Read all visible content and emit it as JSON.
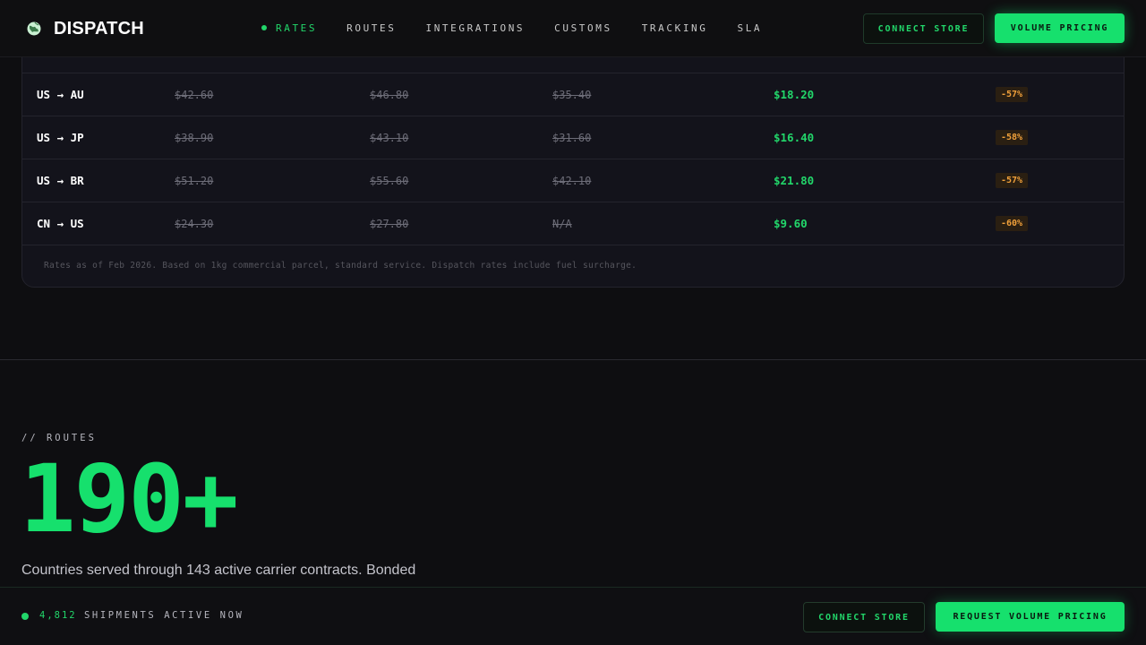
{
  "brand": {
    "name": "DISPATCH",
    "icon": "globe-icon"
  },
  "nav": {
    "links": [
      "RATES",
      "ROUTES",
      "INTEGRATIONS",
      "CUSTOMS",
      "TRACKING",
      "SLA"
    ],
    "active": "RATES",
    "connect_label": "CONNECT STORE",
    "pricing_label": "VOLUME PRICING"
  },
  "rates": {
    "rows": [
      {
        "route": "US → AU",
        "p1": "$42.60",
        "p2": "$46.80",
        "p3": "$35.40",
        "dispatch": "$18.20",
        "saving": "-57%"
      },
      {
        "route": "US → JP",
        "p1": "$38.90",
        "p2": "$43.10",
        "p3": "$31.60",
        "dispatch": "$16.40",
        "saving": "-58%"
      },
      {
        "route": "US → BR",
        "p1": "$51.20",
        "p2": "$55.60",
        "p3": "$42.10",
        "dispatch": "$21.80",
        "saving": "-57%"
      },
      {
        "route": "CN → US",
        "p1": "$24.30",
        "p2": "$27.80",
        "p3": "N/A",
        "dispatch": "$9.60",
        "saving": "-60%"
      }
    ],
    "footnote": "Rates as of Feb 2026. Based on 1kg commercial parcel, standard service. Dispatch rates include fuel surcharge."
  },
  "routes": {
    "eyebrow": "// ROUTES",
    "stat": "190+",
    "description": "Countries served through 143 active carrier contracts. Bonded"
  },
  "bottombar": {
    "count": "4,812",
    "label": "SHIPMENTS ACTIVE NOW",
    "connect_label": "CONNECT STORE",
    "pricing_label": "REQUEST VOLUME PRICING"
  },
  "colors": {
    "accent": "#16e06d",
    "background": "#0e0e11",
    "card": "#13131b",
    "saving_badge": "#f0a03a"
  }
}
